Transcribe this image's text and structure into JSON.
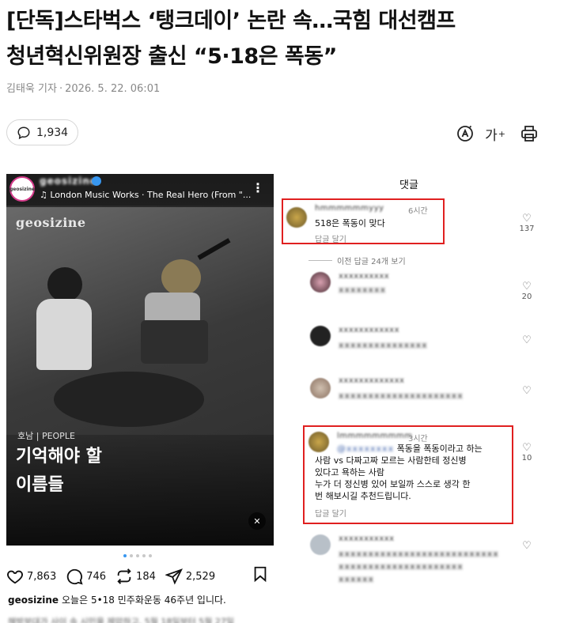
{
  "article": {
    "headline_line1": "[단독]스타벅스 ‘탱크데이’ 논란 속…국힘 대선캠프",
    "headline_line2": "청년혁신위원장 출신 “5·18은 폭동”",
    "author": "김태욱 기자",
    "separator": "·",
    "date": "2026. 5. 22. 06:01",
    "comment_count": "1,934",
    "font_tool_label": "가",
    "font_tool_sup": "+"
  },
  "post": {
    "avatar_text": "geosizine",
    "username": "geosizine",
    "music": "♫ London Music Works · The Real Hero (From \"...",
    "more": "⋮",
    "brand": "geosizine",
    "tag": "호남 | PEOPLE",
    "caption_line1": "기억해야 할",
    "caption_line2": "이름들",
    "mute_icon": "🔇",
    "likes": "7,863",
    "comments": "746",
    "reposts": "184",
    "shares": "2,529",
    "desc_user": "geosizine",
    "desc_text": "오늘은 5•18 민주화운동 46주년 입니다.",
    "desc_blurred": "해방부대가 사이 속 시민을 제압하고, 5월 18일부터 5월 27일"
  },
  "comments_panel": {
    "title": "댓글",
    "view_previous": "이전 답글 24개 보기",
    "comments": [
      {
        "name": "hmmmmmmyyy",
        "time": "6시간",
        "text": "518은 폭동이 맞다",
        "reply": "답글 달기",
        "likes": "137"
      },
      {
        "name": "xxxxxxxxxx",
        "time": "",
        "text": "xxxxxxxx",
        "reply": "",
        "likes": "20"
      },
      {
        "name": "xxxxxxxxxxxx",
        "time": "",
        "text": "xxxxxxxxxxxxxxx",
        "reply": "",
        "likes": ""
      },
      {
        "name": "xxxxxxxxxxxxx",
        "time": "",
        "text": "xxxxxxxxxxxxxxxxxxxxx",
        "reply": "",
        "likes": ""
      },
      {
        "name": "lmmmmmmmmm",
        "time": "3시간",
        "text_prefix": "@xxxxxxxx",
        "text1": "폭동을 폭동이라고 하는",
        "text2": "사람 vs 다짜고짜 모르는 사람한테 정신병",
        "text3": "있다고 욕하는 사람",
        "text4": "누가 더 정신병 있어 보일까 스스로 생각 한",
        "text5": "번 해보시길 추천드립니다.",
        "reply": "답글 달기",
        "likes": "10"
      },
      {
        "name": "xxxxxxxxxxx",
        "time": "",
        "text1": "xxxxxxxxxxxxxxxxxxxxxxxxxxx",
        "text2": "xxxxxxxxxxxxxxxxxxxxx",
        "text3": "xxxxxx",
        "reply": "",
        "likes": ""
      }
    ]
  }
}
